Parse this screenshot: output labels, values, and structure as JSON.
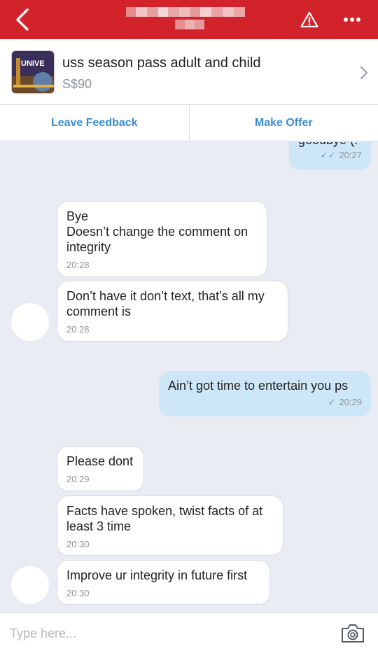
{
  "header": {
    "title_redacted": true
  },
  "listing": {
    "thumb_text": "UNIVE",
    "title": "uss season pass adult and child",
    "price": "S$90"
  },
  "actions": {
    "leave_feedback": "Leave Feedback",
    "make_offer": "Make Offer"
  },
  "messages": [
    {
      "side": "out",
      "text": "goodbye (:",
      "time": "20:27",
      "status": "read"
    },
    {
      "side": "in",
      "text": "Bye\nDoesn’t change the comment on integrity",
      "time": "20:28"
    },
    {
      "side": "in",
      "text": "Don’t have it don’t text, that’s all my comment is",
      "time": "20:28"
    },
    {
      "side": "out",
      "text": "Ain’t got time to entertain you ps",
      "time": "20:29",
      "status": "sent"
    },
    {
      "side": "in",
      "text": "Please dont",
      "time": "20:29"
    },
    {
      "side": "in",
      "text": "Facts have spoken, twist facts of at least 3 time",
      "time": "20:30"
    },
    {
      "side": "in",
      "text": "Improve ur integrity in future first",
      "time": "20:30"
    }
  ],
  "input": {
    "placeholder": "Type here..."
  },
  "colors": {
    "header_red": "#d2232a",
    "link_blue": "#3a8bd6",
    "outgoing_bubble": "#cde7f8",
    "chat_background": "#e9ecf3"
  },
  "icons": {
    "back": "chevron-left-icon",
    "warning": "warning-triangle-icon",
    "more": "more-dots-icon",
    "listing_chevron": "chevron-right-icon",
    "camera": "camera-icon"
  }
}
